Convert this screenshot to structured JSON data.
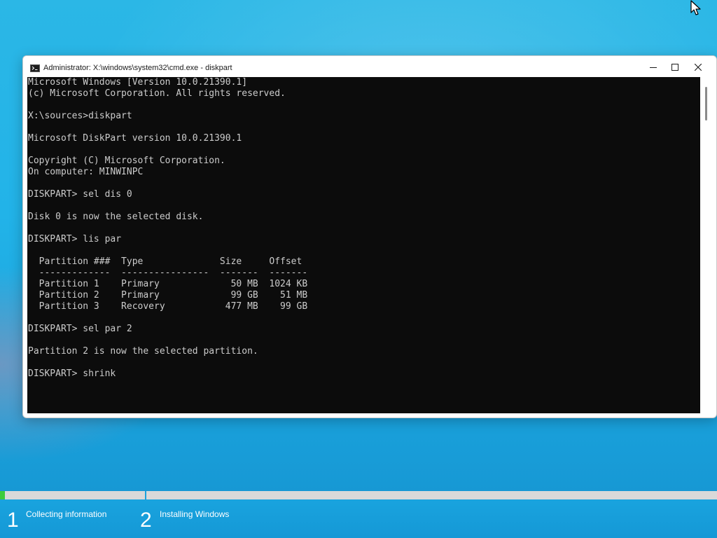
{
  "window": {
    "title": "Administrator: X:\\windows\\system32\\cmd.exe - diskpart"
  },
  "console": {
    "lines": [
      "Microsoft Windows [Version 10.0.21390.1]",
      "(c) Microsoft Corporation. All rights reserved.",
      "",
      "X:\\sources>diskpart",
      "",
      "Microsoft DiskPart version 10.0.21390.1",
      "",
      "Copyright (C) Microsoft Corporation.",
      "On computer: MINWINPC",
      "",
      "DISKPART> sel dis 0",
      "",
      "Disk 0 is now the selected disk.",
      "",
      "DISKPART> lis par",
      "",
      "  Partition ###  Type              Size     Offset",
      "  -------------  ----------------  -------  -------",
      "  Partition 1    Primary             50 MB  1024 KB",
      "  Partition 2    Primary             99 GB    51 MB",
      "  Partition 3    Recovery           477 MB    99 GB",
      "",
      "DISKPART> sel par 2",
      "",
      "Partition 2 is now the selected partition.",
      "",
      "DISKPART> shrink"
    ]
  },
  "setup": {
    "progress_fraction": 0.007,
    "steps": [
      {
        "number": "1",
        "label": "Collecting information"
      },
      {
        "number": "2",
        "label": "Installing Windows"
      }
    ]
  },
  "icons": {
    "titlebar": "cmd-icon",
    "minimize": "minimize-icon",
    "maximize": "maximize-icon",
    "close": "close-icon",
    "cursor": "mouse-cursor-icon"
  },
  "colors": {
    "console_bg": "#0c0c0c",
    "console_fg": "#cccccc",
    "progress": "#3ccc3c"
  }
}
